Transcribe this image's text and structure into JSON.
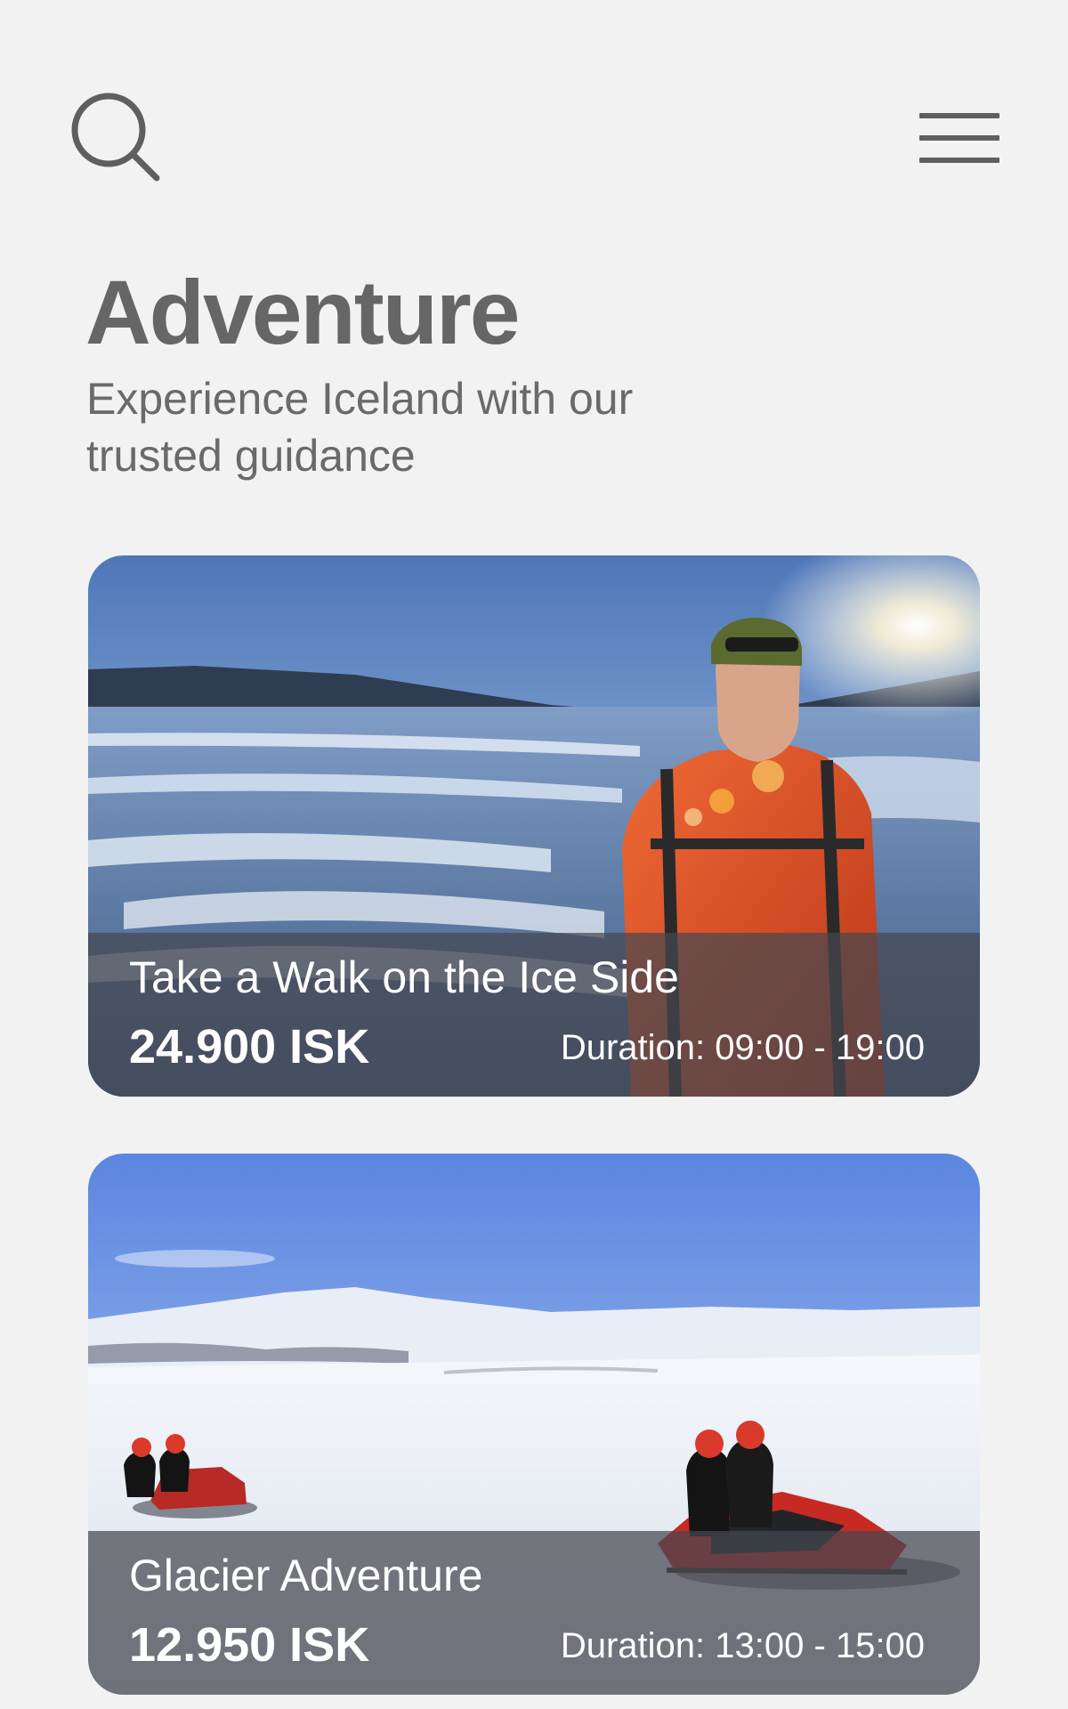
{
  "header": {
    "search_icon": "search-icon",
    "menu_icon": "hamburger-menu-icon"
  },
  "page": {
    "title": "Adventure",
    "subtitle": "Experience Iceland with our trusted guidance"
  },
  "tours": [
    {
      "title": "Take a Walk on the Ice Side",
      "price": "24.900 ISK",
      "duration": "Duration: 09:00 - 19:00",
      "image": "glacier-hiker-photo"
    },
    {
      "title": "Glacier Adventure",
      "price": "12.950 ISK",
      "duration": "Duration: 13:00 - 15:00",
      "image": "snowmobile-photo"
    }
  ],
  "colors": {
    "background": "#f2f2f2",
    "text": "#666666",
    "overlay": "#464850",
    "overlay_text": "#ffffff"
  }
}
